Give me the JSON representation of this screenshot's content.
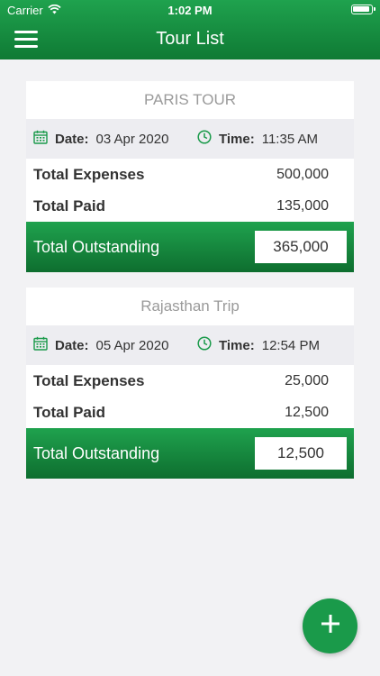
{
  "status_bar": {
    "carrier": "Carrier",
    "time": "1:02 PM"
  },
  "header": {
    "title": "Tour List"
  },
  "tours": [
    {
      "name": "PARIS TOUR",
      "date_label": "Date:",
      "date": "03 Apr 2020",
      "time_label": "Time:",
      "time": "11:35 AM",
      "expenses_label": "Total Expenses",
      "expenses": "500,000",
      "paid_label": "Total Paid",
      "paid": "135,000",
      "outstanding_label": "Total Outstanding",
      "outstanding": "365,000"
    },
    {
      "name": "Rajasthan Trip",
      "date_label": "Date:",
      "date": "05 Apr 2020",
      "time_label": "Time:",
      "time": "12:54 PM",
      "expenses_label": "Total Expenses",
      "expenses": "25,000",
      "paid_label": "Total Paid",
      "paid": "12,500",
      "outstanding_label": "Total Outstanding",
      "outstanding": "12,500"
    }
  ],
  "fab": {
    "icon": "plus-icon"
  },
  "colors": {
    "accent": "#1a9a4a",
    "accent_dark": "#0f7a34",
    "background": "#f2f2f4"
  }
}
